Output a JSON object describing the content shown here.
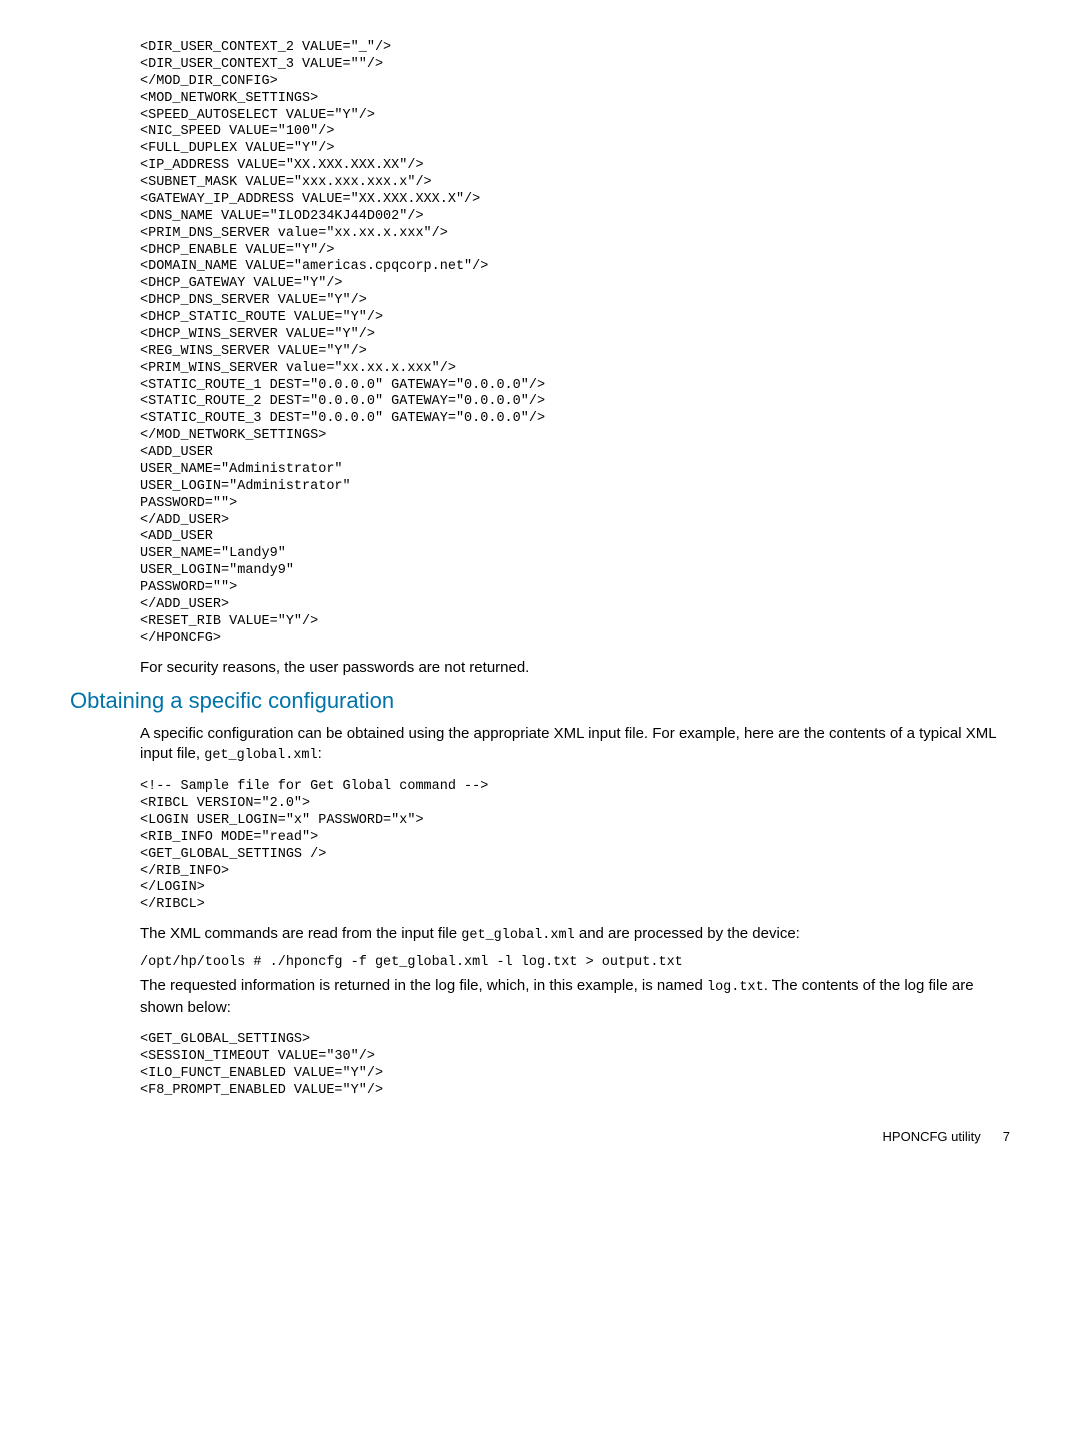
{
  "code1": "<DIR_USER_CONTEXT_2 VALUE=\"_\"/>\n<DIR_USER_CONTEXT_3 VALUE=\"\"/>\n</MOD_DIR_CONFIG>\n<MOD_NETWORK_SETTINGS>\n<SPEED_AUTOSELECT VALUE=\"Y\"/>\n<NIC_SPEED VALUE=\"100\"/>\n<FULL_DUPLEX VALUE=\"Y\"/>\n<IP_ADDRESS VALUE=\"XX.XXX.XXX.XX\"/>\n<SUBNET_MASK VALUE=\"xxx.xxx.xxx.x\"/>\n<GATEWAY_IP_ADDRESS VALUE=\"XX.XXX.XXX.X\"/>\n<DNS_NAME VALUE=\"ILOD234KJ44D002\"/>\n<PRIM_DNS_SERVER value=\"xx.xx.x.xxx\"/>\n<DHCP_ENABLE VALUE=\"Y\"/>\n<DOMAIN_NAME VALUE=\"americas.cpqcorp.net\"/>\n<DHCP_GATEWAY VALUE=\"Y\"/>\n<DHCP_DNS_SERVER VALUE=\"Y\"/>\n<DHCP_STATIC_ROUTE VALUE=\"Y\"/>\n<DHCP_WINS_SERVER VALUE=\"Y\"/>\n<REG_WINS_SERVER VALUE=\"Y\"/>\n<PRIM_WINS_SERVER value=\"xx.xx.x.xxx\"/>\n<STATIC_ROUTE_1 DEST=\"0.0.0.0\" GATEWAY=\"0.0.0.0\"/>\n<STATIC_ROUTE_2 DEST=\"0.0.0.0\" GATEWAY=\"0.0.0.0\"/>\n<STATIC_ROUTE_3 DEST=\"0.0.0.0\" GATEWAY=\"0.0.0.0\"/>\n</MOD_NETWORK_SETTINGS>\n<ADD_USER\nUSER_NAME=\"Administrator\"\nUSER_LOGIN=\"Administrator\"\nPASSWORD=\"\">\n</ADD_USER>\n<ADD_USER\nUSER_NAME=\"Landy9\"\nUSER_LOGIN=\"mandy9\"\nPASSWORD=\"\">\n</ADD_USER>\n<RESET_RIB VALUE=\"Y\"/>\n</HPONCFG>",
  "para1": "For security reasons, the user passwords are not returned.",
  "section_title": "Obtaining a specific configuration",
  "para2_a": "A specific configuration can be obtained using the appropriate XML input file. For example, here are the contents of a typical XML input file, ",
  "para2_code": "get_global.xml",
  "para2_b": ":",
  "code2": "<!-- Sample file for Get Global command -->\n<RIBCL VERSION=\"2.0\">\n<LOGIN USER_LOGIN=\"x\" PASSWORD=\"x\">\n<RIB_INFO MODE=\"read\">\n<GET_GLOBAL_SETTINGS />\n</RIB_INFO>\n</LOGIN>\n</RIBCL>",
  "para3_a": "The XML commands are read from the input file ",
  "para3_code": "get_global.xml",
  "para3_b": " and are processed by the device:",
  "cmd_line": "/opt/hp/tools # ./hponcfg -f get_global.xml -l log.txt > output.txt",
  "para4_a": "The requested information is returned in the log file, which, in this example, is named ",
  "para4_code": "log.txt",
  "para4_b": ". The contents of the log file are shown below:",
  "code3": "<GET_GLOBAL_SETTINGS>\n<SESSION_TIMEOUT VALUE=\"30\"/>\n<ILO_FUNCT_ENABLED VALUE=\"Y\"/>\n<F8_PROMPT_ENABLED VALUE=\"Y\"/>",
  "footer_label": "HPONCFG utility",
  "footer_page": "7"
}
